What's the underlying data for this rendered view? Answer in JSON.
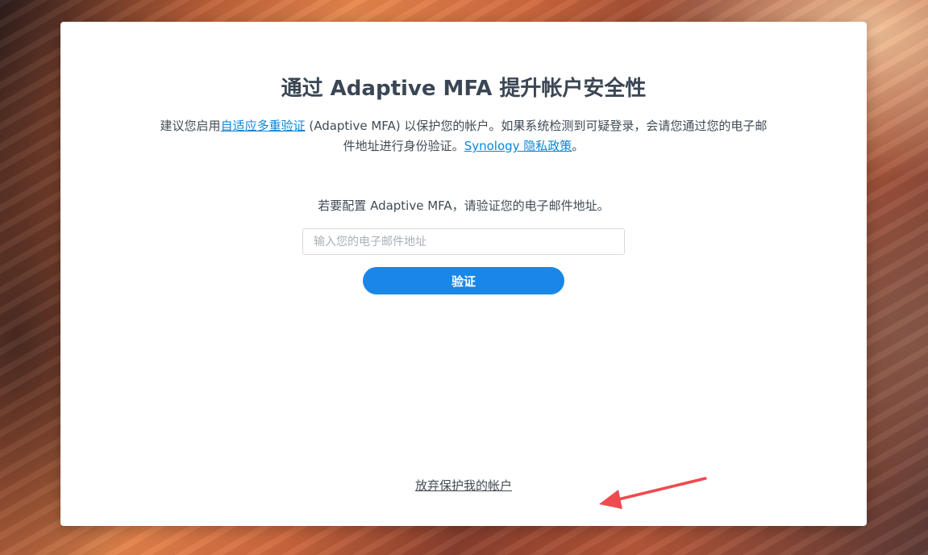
{
  "card": {
    "title": "通过 Adaptive MFA 提升帐户安全性",
    "description": {
      "prefix": "建议您启用",
      "link1": "自适应多重验证",
      "middle": " (Adaptive MFA) 以保护您的帐户。如果系统检测到可疑登录，会请您通过您的电子邮件地址进行身份验证。",
      "link2": "Synology 隐私政策",
      "suffix": "。"
    },
    "prompt": "若要配置 Adaptive MFA，请验证您的电子邮件地址。",
    "email_input": {
      "value": "",
      "placeholder": "输入您的电子邮件地址"
    },
    "verify_label": "验证",
    "abandon_label": "放弃保护我的帐户"
  },
  "colors": {
    "primary": "#1a86e8",
    "link": "#0a86d8",
    "annotation_arrow": "#ef4a4f"
  }
}
